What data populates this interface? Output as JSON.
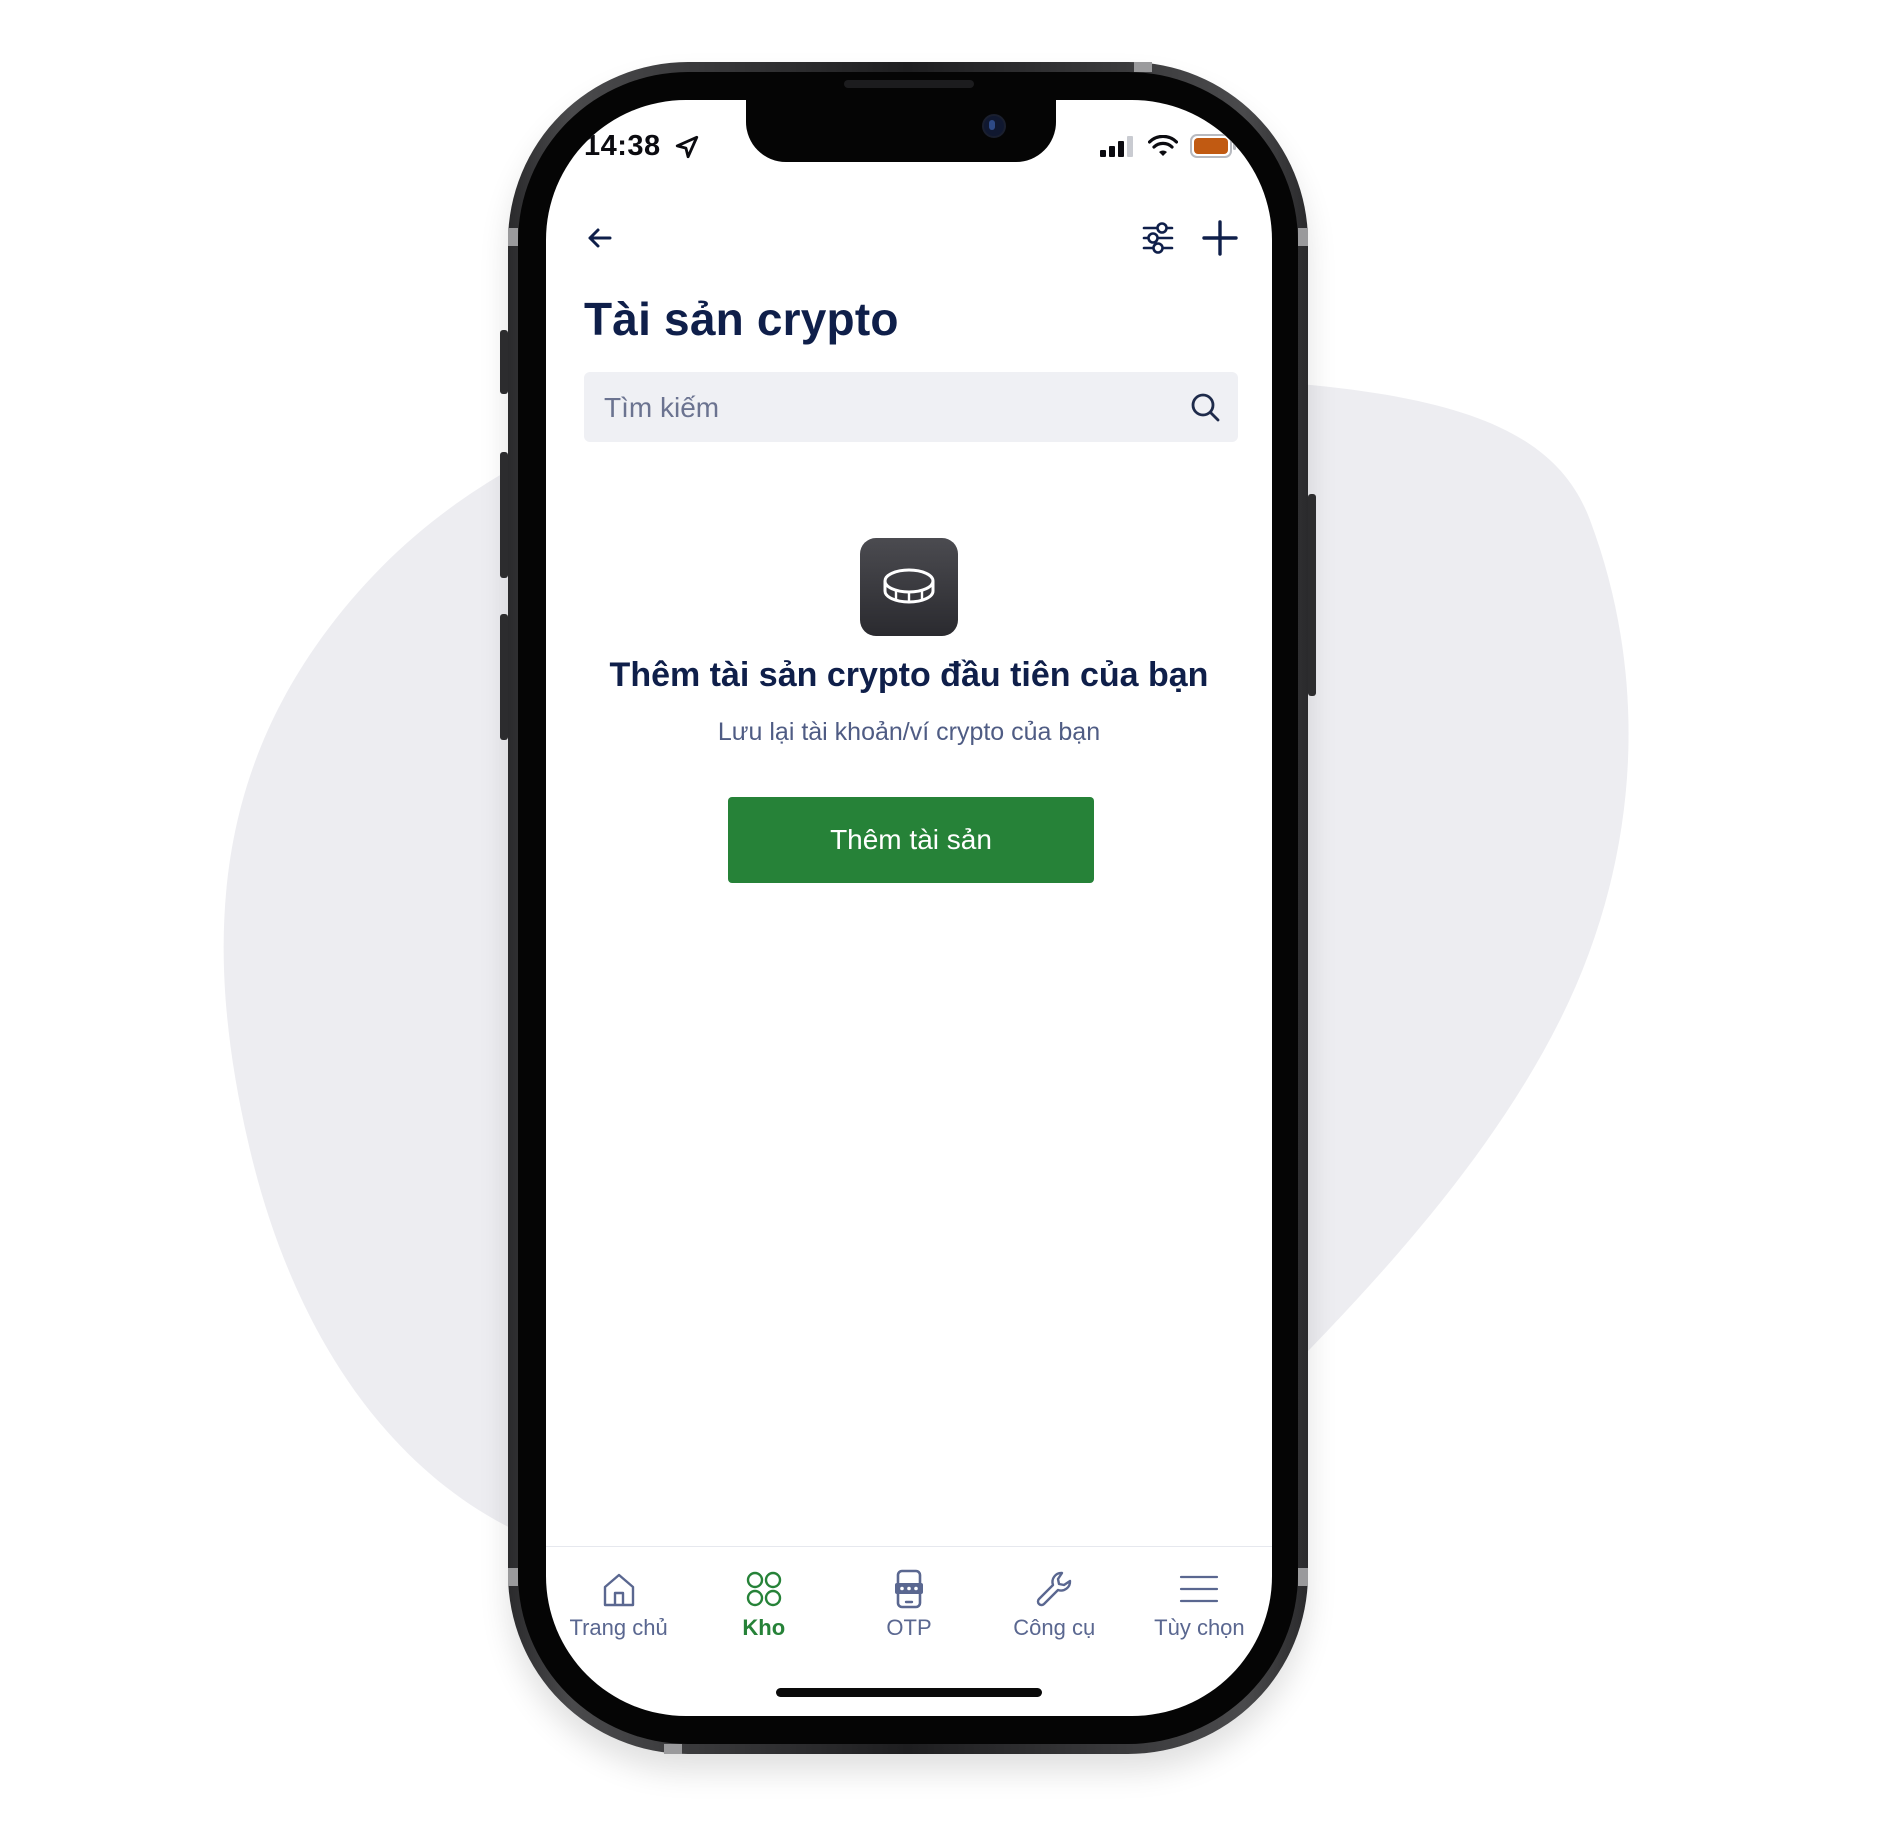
{
  "status_bar": {
    "time": "14:38"
  },
  "header": {
    "title": "Tài sản crypto"
  },
  "search": {
    "placeholder": "Tìm kiếm",
    "value": ""
  },
  "empty_state": {
    "icon": "coin-icon",
    "title": "Thêm tài sản crypto đầu tiên của bạn",
    "subtitle": "Lưu lại tài khoản/ví crypto của bạn",
    "button_label": "Thêm tài sản"
  },
  "tabbar": {
    "items": [
      {
        "label": "Trang chủ",
        "icon": "home-icon",
        "active": false
      },
      {
        "label": "Kho",
        "icon": "grid-icon",
        "active": true
      },
      {
        "label": "OTP",
        "icon": "otp-phone-icon",
        "active": false
      },
      {
        "label": "Công cụ",
        "icon": "wrench-icon",
        "active": false
      },
      {
        "label": "Tùy chọn",
        "icon": "menu-icon",
        "active": false
      }
    ]
  },
  "colors": {
    "accent_green": "#268238",
    "title_navy": "#0f1f4a",
    "muted_text": "#5a6790",
    "search_bg": "#eff0f4",
    "backdrop_blob": "#ededf1",
    "battery_fill": "#c15a12"
  }
}
